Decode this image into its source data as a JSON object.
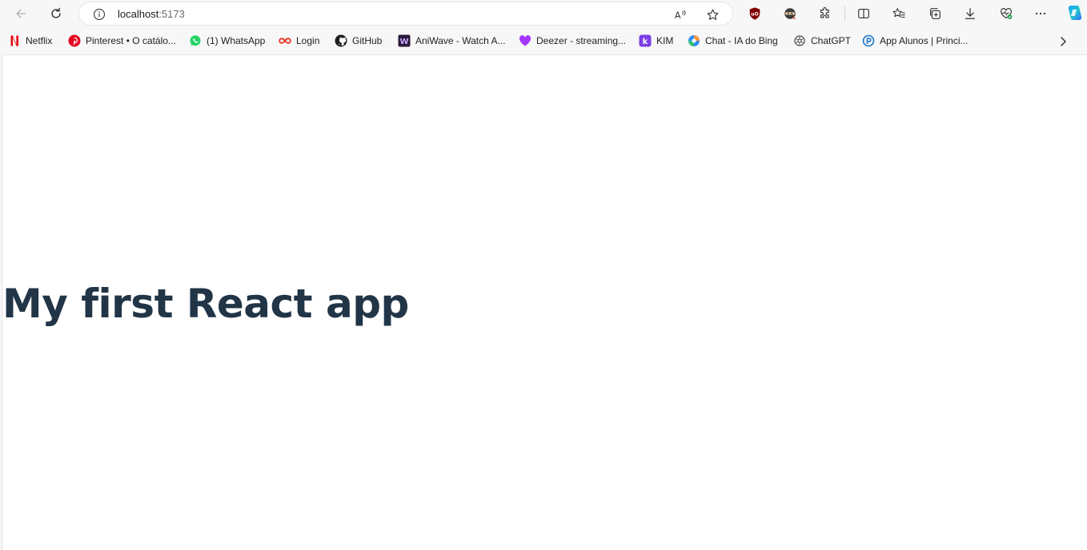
{
  "browser": {
    "address_bar": {
      "host": "localhost",
      "port": ":5173"
    },
    "toolbar_icons": {
      "back": "back-arrow-icon",
      "refresh": "refresh-icon",
      "info": "info-icon",
      "read_aloud": "read-aloud-icon",
      "favorite": "star-icon",
      "ublock": "ublock-icon",
      "ninja_ext": "ninja-extension-icon",
      "extensions": "puzzle-icon",
      "split": "split-screen-icon",
      "favorites": "favorites-icon",
      "collections": "collections-icon",
      "downloads": "download-icon",
      "performance": "heart-pulse-icon",
      "more": "more-icon",
      "copilot": "copilot-icon"
    },
    "bookmarks": [
      {
        "label": "Netflix",
        "icon": "netflix-icon",
        "color": "#e50914"
      },
      {
        "label": "Pinterest • O catálo...",
        "icon": "pinterest-icon",
        "color": "#e60023"
      },
      {
        "label": "(1) WhatsApp",
        "icon": "whatsapp-icon",
        "color": "#25d366"
      },
      {
        "label": "Login",
        "icon": "login-infinity-icon",
        "color": "#e8321e"
      },
      {
        "label": "GitHub",
        "icon": "github-icon",
        "color": "#1f1f1f"
      },
      {
        "label": "AniWave - Watch A...",
        "icon": "aniwave-icon",
        "color": "#2b1a3a"
      },
      {
        "label": "Deezer - streaming...",
        "icon": "deezer-heart-icon",
        "color": "#a238ff"
      },
      {
        "label": "KIM",
        "icon": "kim-icon",
        "color": "#7b3fe4"
      },
      {
        "label": "Chat - IA do Bing",
        "icon": "bing-chat-icon",
        "color": "#2f8cff"
      },
      {
        "label": "ChatGPT",
        "icon": "chatgpt-icon",
        "color": "#444444"
      },
      {
        "label": "App Alunos | Princi...",
        "icon": "app-alunos-icon",
        "color": "#1a73c8"
      }
    ]
  },
  "page": {
    "heading": "My first React app",
    "heading_color": "#213547"
  }
}
